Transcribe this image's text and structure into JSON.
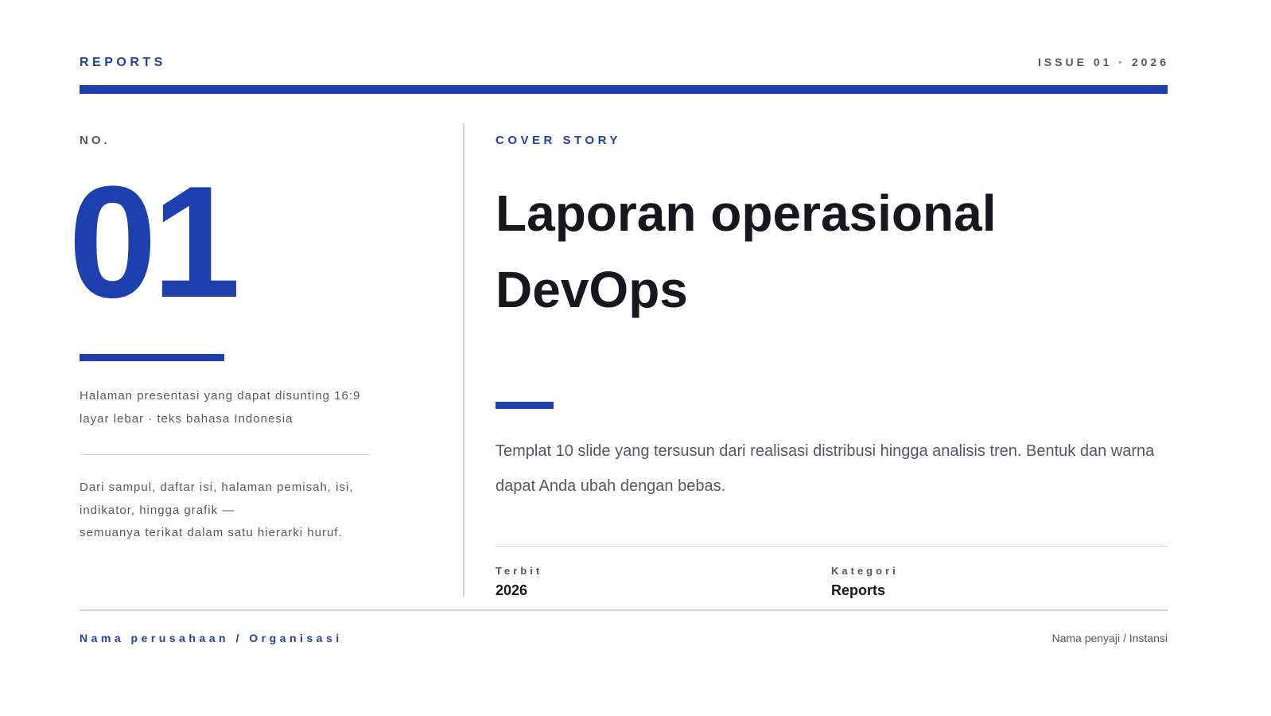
{
  "header": {
    "brand": "REPORTS",
    "issue": "ISSUE 01 · 2026"
  },
  "left": {
    "no_label": "NO.",
    "number": "01",
    "subtitle": "Halaman presentasi yang dapat disunting 16:9 layar lebar · teks bahasa Indonesia",
    "description_lines": [
      "Dari sampul, daftar isi, halaman pemisah, isi,",
      "indikator, hingga grafik —",
      "semuanya terikat dalam satu hierarki huruf."
    ]
  },
  "main": {
    "kicker": "COVER STORY",
    "title_lines": [
      "Laporan operasional",
      "DevOps"
    ],
    "lede": "Templat 10 slide yang tersusun dari realisasi distribusi hingga analisis tren. Bentuk dan warna dapat Anda ubah dengan bebas.",
    "meta": [
      {
        "label": "Terbit",
        "value": "2026"
      },
      {
        "label": "Kategori",
        "value": "Reports"
      }
    ]
  },
  "footer": {
    "organization": "Nama perusahaan / Organisasi",
    "presenter": "Nama penyaji / Instansi"
  },
  "colors": {
    "accent": "#1e3fae",
    "text": "#16181d",
    "muted": "#55585f",
    "rule": "#cfd1d6",
    "background": "#ffffff"
  }
}
